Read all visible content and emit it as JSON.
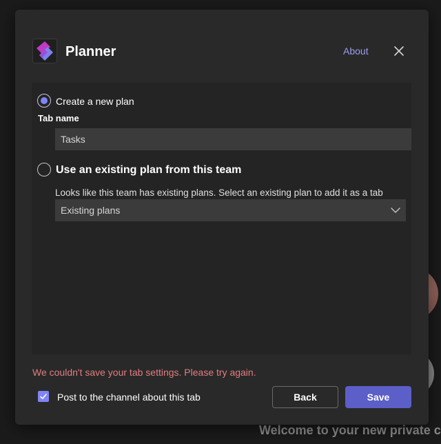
{
  "background": {
    "welcome_text": "Welcome to your new private cl"
  },
  "dialog": {
    "app_name": "Planner",
    "about_link": "About",
    "close_icon": "close-icon",
    "logo_icon": "planner-logo-icon"
  },
  "options": {
    "create_new_label": "Create a new plan",
    "create_new_selected": true,
    "tab_name_label": "Tab name",
    "tab_name_value": "Tasks",
    "use_existing_label": "Use an existing plan from this team",
    "use_existing_selected": false,
    "existing_description": "Looks like this team has existing plans. Select an existing plan to add it as a tab",
    "existing_plans_value": "Existing plans"
  },
  "footer": {
    "error_message": "We couldn't save your tab settings. Please try again.",
    "post_to_channel_label": "Post to the channel about this tab",
    "post_to_channel_checked": true,
    "back_label": "Back",
    "save_label": "Save"
  },
  "colors": {
    "accent": "#5b5fc7",
    "link": "#9c9ef0",
    "error": "#e37d80"
  }
}
